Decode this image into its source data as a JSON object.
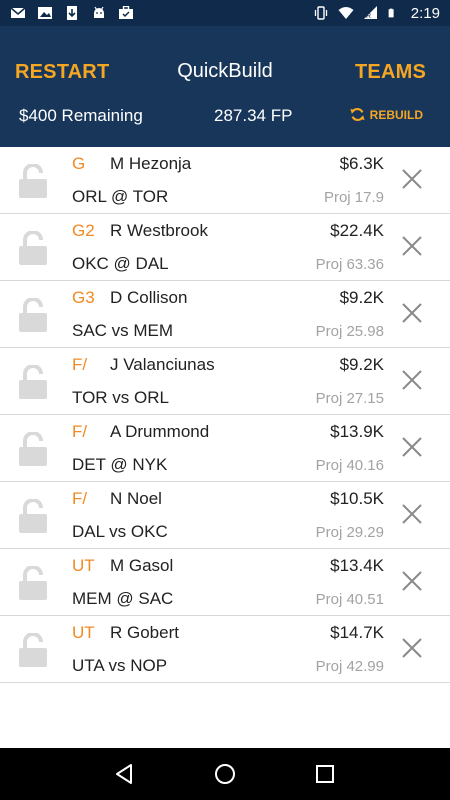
{
  "status_bar": {
    "time": "2:19",
    "left_icons": [
      "gmail-icon",
      "image-icon",
      "download-icon",
      "android-icon",
      "briefcase-icon"
    ],
    "right_icons": [
      "vibrate-icon",
      "wifi-icon",
      "cellular-icon",
      "battery-icon"
    ]
  },
  "header": {
    "restart_label": "RESTART",
    "title": "QuickBuild",
    "teams_label": "TEAMS",
    "remaining": "$400 Remaining",
    "fp": "287.34 FP",
    "rebuild_label": "REBUILD"
  },
  "players": [
    {
      "pos": "G",
      "name": "M Hezonja",
      "matchup": "ORL @ TOR",
      "salary": "$6.3K",
      "proj": "Proj 17.9"
    },
    {
      "pos": "G2",
      "name": "R Westbrook",
      "matchup": "OKC @ DAL",
      "salary": "$22.4K",
      "proj": "Proj 63.36"
    },
    {
      "pos": "G3",
      "name": "D Collison",
      "matchup": "SAC vs MEM",
      "salary": "$9.2K",
      "proj": "Proj 25.98"
    },
    {
      "pos": "F/",
      "name": "J Valanciunas",
      "matchup": "TOR vs ORL",
      "salary": "$9.2K",
      "proj": "Proj 27.15"
    },
    {
      "pos": "F/",
      "name": "A Drummond",
      "matchup": "DET @ NYK",
      "salary": "$13.9K",
      "proj": "Proj 40.16"
    },
    {
      "pos": "F/",
      "name": "N Noel",
      "matchup": "DAL vs OKC",
      "salary": "$10.5K",
      "proj": "Proj 29.29"
    },
    {
      "pos": "UT",
      "name": "M Gasol",
      "matchup": "MEM @ SAC",
      "salary": "$13.4K",
      "proj": "Proj 40.51"
    },
    {
      "pos": "UT",
      "name": "R Gobert",
      "matchup": "UTA vs NOP",
      "salary": "$14.7K",
      "proj": "Proj 42.99"
    }
  ],
  "colors": {
    "header_bg": "#17365a",
    "accent": "#f5a623",
    "position": "#f08a24"
  }
}
